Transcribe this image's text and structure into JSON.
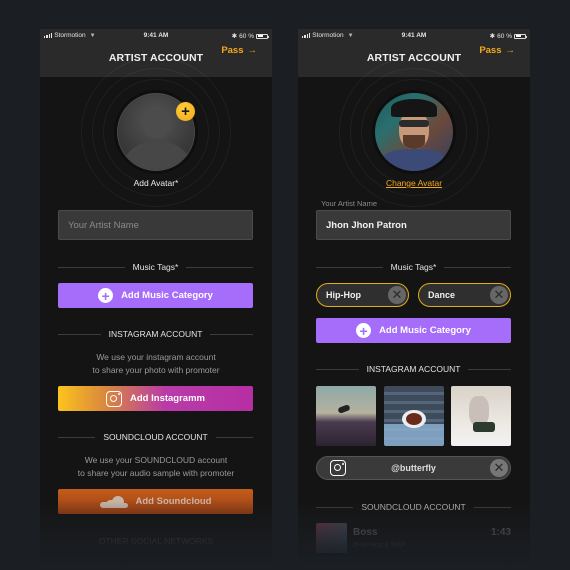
{
  "status_bar": {
    "carrier": "Stormotion",
    "time": "9:41 AM",
    "battery": "60 %",
    "battery_level_percent": 60
  },
  "header": {
    "title": "ARTIST ACCOUNT",
    "pass_label": "Pass",
    "pass_icon": "arrow-right-icon"
  },
  "left_screen": {
    "avatar_caption": "Add Avatar*",
    "artist_name_placeholder": "Your Artist Name",
    "music_tags_heading": "Music Tags*",
    "add_music_category": "Add Music Category",
    "instagram_heading": "INSTAGRAM ACCOUNT",
    "instagram_desc_line1": "We use your instagram account",
    "instagram_desc_line2": "to share your photo with promoter",
    "add_instagram": "Add Instagramm",
    "soundcloud_heading": "SOUNDCLOUD ACCOUNT",
    "soundcloud_desc_line1": "We use your SOUNDCLOUD account",
    "soundcloud_desc_line2": "to share your audio sample with promoter",
    "add_soundcloud": "Add Soundcloud",
    "other_networks_heading": "OTHER SOCIAL NETWORKS"
  },
  "right_screen": {
    "change_avatar": "Change Avatar",
    "artist_name_label": "Your Artist Name",
    "artist_name_value": "Jhon Jhon Patron",
    "music_tags_heading": "Music Tags*",
    "tags": [
      {
        "label": "Hip-Hop"
      },
      {
        "label": "Dance"
      }
    ],
    "add_music_category": "Add Music Category",
    "instagram_heading": "INSTAGRAM ACCOUNT",
    "instagram_photos": [
      "skateboard-jump-photo",
      "tea-cup-photo",
      "woman-camera-photo"
    ],
    "instagram_handle": "@butterfly",
    "soundcloud_heading": "SOUNDCLOUD ACCOUNT",
    "track": {
      "name": "Boss",
      "genre": "#Hip-Hop & RAP",
      "duration": "1:43"
    }
  },
  "colors": {
    "accent": "#f4a81d",
    "purple": "#a56dfa",
    "background": "#1b1e22",
    "screen": "#141414"
  }
}
